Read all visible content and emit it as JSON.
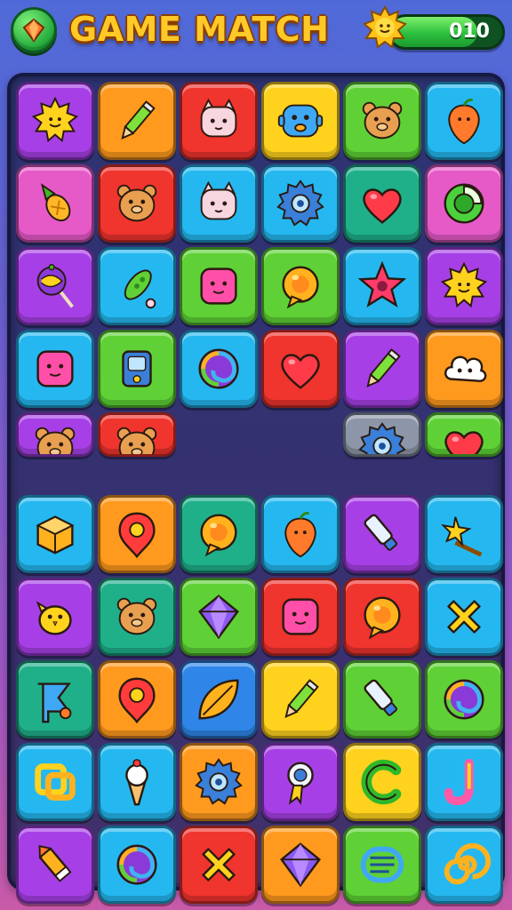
{
  "header": {
    "title": "GAME MATCH",
    "score": "010",
    "score_progress": 0.78,
    "menu_icon": "gem-icon",
    "score_icon": "sun-icon"
  },
  "palette": {
    "purple": "#a640e6",
    "orange": "#ff9a1f",
    "red": "#f0342e",
    "yellow": "#ffd21e",
    "green": "#5fd136",
    "cyan": "#25b8f0",
    "pink": "#e65ac8",
    "blue": "#2f86e8",
    "teal": "#1fb08a",
    "gray": "#8d96a8"
  },
  "board": {
    "rows": [
      [
        {
          "color": "purple",
          "icon": "sun"
        },
        {
          "color": "orange",
          "icon": "pencil"
        },
        {
          "color": "red",
          "icon": "cat"
        },
        {
          "color": "yellow",
          "icon": "robot"
        },
        {
          "color": "green",
          "icon": "bear"
        },
        {
          "color": "cyan",
          "icon": "fruit"
        }
      ],
      [
        {
          "color": "pink",
          "icon": "pineapple"
        },
        {
          "color": "red",
          "icon": "bear"
        },
        {
          "color": "cyan",
          "icon": "cat"
        },
        {
          "color": "cyan",
          "icon": "gear"
        },
        {
          "color": "teal",
          "icon": "heart"
        },
        {
          "color": "pink",
          "icon": "chart"
        }
      ],
      [
        {
          "color": "purple",
          "icon": "lollipop"
        },
        {
          "color": "cyan",
          "icon": "pea"
        },
        {
          "color": "green",
          "icon": "square"
        },
        {
          "color": "green",
          "icon": "bubble"
        },
        {
          "color": "cyan",
          "icon": "star"
        },
        {
          "color": "purple",
          "icon": "sun"
        }
      ],
      [
        {
          "color": "cyan",
          "icon": "square"
        },
        {
          "color": "green",
          "icon": "phone"
        },
        {
          "color": "cyan",
          "icon": "swirl"
        },
        {
          "color": "red",
          "icon": "heart"
        },
        {
          "color": "purple",
          "icon": "pencil"
        },
        {
          "color": "orange",
          "icon": "cloud"
        }
      ],
      [
        {
          "color": "purple",
          "icon": "bear"
        },
        {
          "color": "red",
          "icon": "bear"
        },
        null,
        null,
        {
          "color": "gray",
          "icon": "gear"
        },
        {
          "color": "green",
          "icon": "heart"
        }
      ],
      [
        {
          "color": "cyan",
          "icon": "cube"
        },
        {
          "color": "orange",
          "icon": "pin"
        },
        {
          "color": "teal",
          "icon": "bubble"
        },
        {
          "color": "cyan",
          "icon": "fruit"
        },
        {
          "color": "purple",
          "icon": "tube"
        },
        {
          "color": "cyan",
          "icon": "wand"
        }
      ],
      [
        {
          "color": "purple",
          "icon": "chick"
        },
        {
          "color": "teal",
          "icon": "bear"
        },
        {
          "color": "green",
          "icon": "gem"
        },
        {
          "color": "red",
          "icon": "square"
        },
        {
          "color": "red",
          "icon": "bubble"
        },
        {
          "color": "cyan",
          "icon": "cross"
        }
      ],
      [
        {
          "color": "teal",
          "icon": "flag"
        },
        {
          "color": "orange",
          "icon": "pin"
        },
        {
          "color": "blue",
          "icon": "leaf"
        },
        {
          "color": "yellow",
          "icon": "pencil"
        },
        {
          "color": "green",
          "icon": "tube"
        },
        {
          "color": "green",
          "icon": "swirl"
        }
      ],
      [
        {
          "color": "cyan",
          "icon": "knot"
        },
        {
          "color": "cyan",
          "icon": "cone"
        },
        {
          "color": "orange",
          "icon": "gear"
        },
        {
          "color": "purple",
          "icon": "ribbon"
        },
        {
          "color": "yellow",
          "icon": "letter-c"
        },
        {
          "color": "cyan",
          "icon": "letter-j"
        }
      ],
      [
        {
          "color": "purple",
          "icon": "crayon"
        },
        {
          "color": "cyan",
          "icon": "swirl"
        },
        {
          "color": "red",
          "icon": "cross"
        },
        {
          "color": "orange",
          "icon": "gem"
        },
        {
          "color": "green",
          "icon": "coil"
        },
        {
          "color": "cyan",
          "icon": "spiral"
        }
      ]
    ]
  }
}
